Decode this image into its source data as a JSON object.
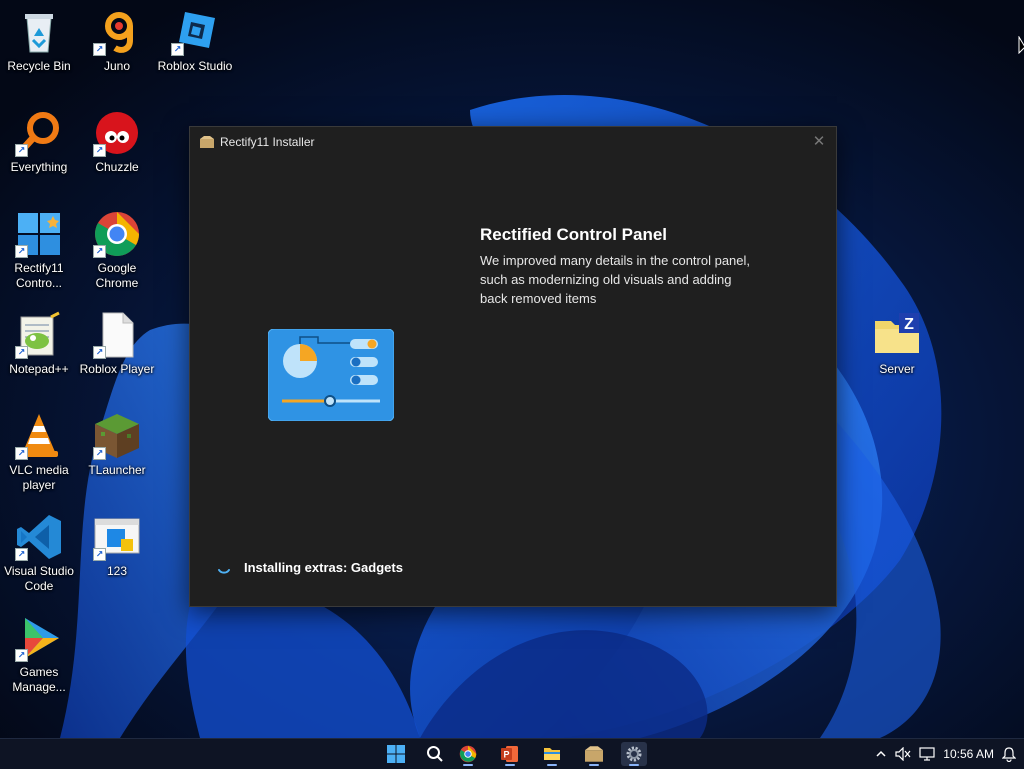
{
  "desktop": {
    "icons": [
      {
        "label": "Recycle Bin",
        "icon": "recycle-bin-icon"
      },
      {
        "label": "Juno",
        "icon": "juno-icon"
      },
      {
        "label": "Roblox Studio",
        "icon": "roblox-studio-icon"
      },
      {
        "label": "Everything",
        "icon": "everything-search-icon"
      },
      {
        "label": "Chuzzle",
        "icon": "chuzzle-icon"
      },
      {
        "label": "Rectify11 Contro...",
        "icon": "rectify11-control-icon"
      },
      {
        "label": "Google Chrome",
        "icon": "chrome-icon"
      },
      {
        "label": "Notepad++",
        "icon": "notepadpp-icon"
      },
      {
        "label": "Roblox Player",
        "icon": "blank-file-icon"
      },
      {
        "label": "VLC media player",
        "icon": "vlc-icon"
      },
      {
        "label": "TLauncher",
        "icon": "tlauncher-icon"
      },
      {
        "label": "Visual Studio Code",
        "icon": "vscode-icon"
      },
      {
        "label": "123",
        "icon": "app-window-icon"
      },
      {
        "label": "Games Manage...",
        "icon": "games-manager-icon"
      },
      {
        "label": "Server",
        "icon": "server-folder-icon"
      }
    ]
  },
  "installer": {
    "title": "Rectify11 Installer",
    "close_glyph": "✕",
    "feature_title": "Rectified Control Panel",
    "feature_description": "We improved many details in the control panel, such as modernizing old visuals and adding back removed items",
    "status": "Installing extras: Gadgets"
  },
  "taskbar": {
    "apps": [
      "start",
      "search",
      "chrome",
      "powerpoint",
      "file-explorer",
      "rectify11-installer",
      "settings"
    ],
    "time": "10:56 AM"
  },
  "colors": {
    "accent": "#3a8fd6",
    "window_bg": "#1f1f1f",
    "taskbar_bg": "#0e1424"
  }
}
